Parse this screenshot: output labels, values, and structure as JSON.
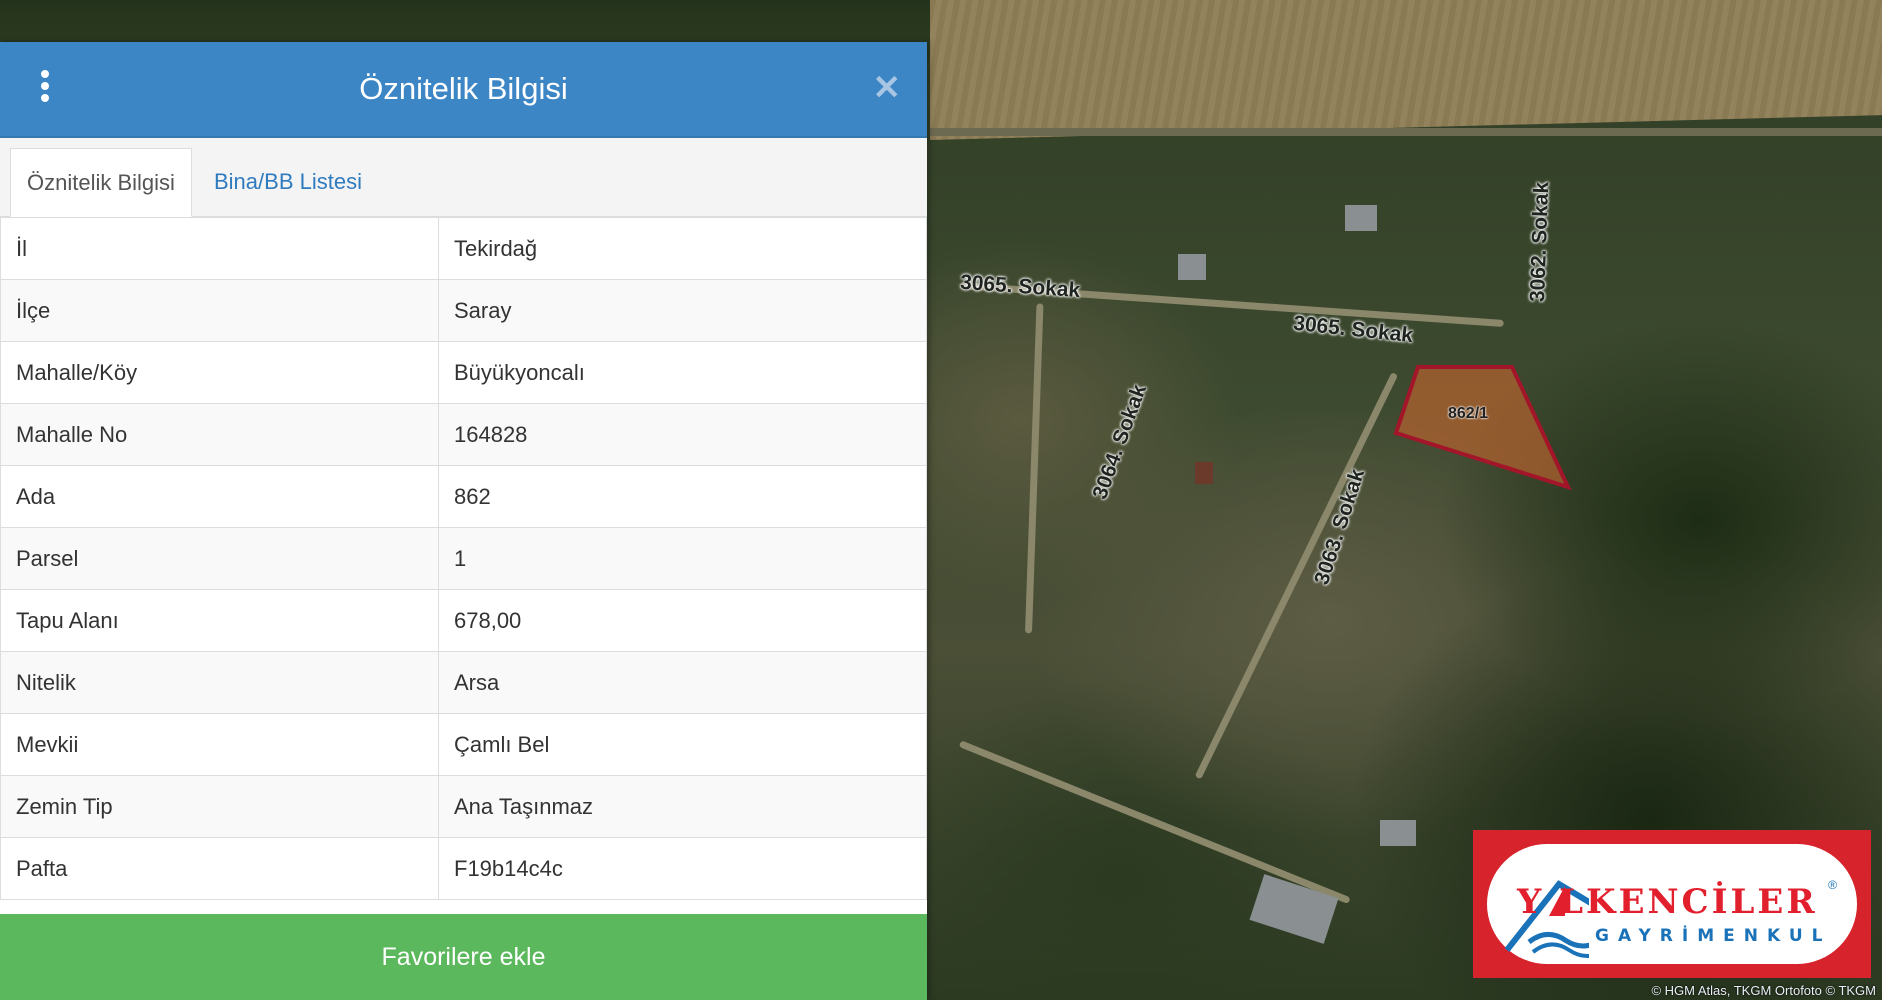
{
  "panel": {
    "title": "Öznitelik Bilgisi",
    "tabs": [
      {
        "label": "Öznitelik Bilgisi",
        "active": true
      },
      {
        "label": "Bina/BB Listesi",
        "active": false
      }
    ],
    "rows": [
      {
        "key": "İl",
        "value": "Tekirdağ"
      },
      {
        "key": "İlçe",
        "value": "Saray"
      },
      {
        "key": "Mahalle/Köy",
        "value": "Büyükyoncalı"
      },
      {
        "key": "Mahalle No",
        "value": "164828"
      },
      {
        "key": "Ada",
        "value": "862"
      },
      {
        "key": "Parsel",
        "value": "1"
      },
      {
        "key": "Tapu Alanı",
        "value": "678,00"
      },
      {
        "key": "Nitelik",
        "value": "Arsa"
      },
      {
        "key": "Mevkii",
        "value": "Çamlı Bel"
      },
      {
        "key": "Zemin Tip",
        "value": "Ana Taşınmaz"
      },
      {
        "key": "Pafta",
        "value": "F19b14c4c"
      }
    ],
    "favorite_button": "Favorilere ekle",
    "icons": {
      "menu": "kebab-menu-icon",
      "close": "close-icon"
    }
  },
  "map": {
    "streets": [
      "3065. Sokak",
      "3065. Sokak",
      "3064. Sokak",
      "3063. Sokak",
      "3062. Sokak"
    ],
    "parcel_label": "862/1",
    "attribution": "© HGM Atlas, TKGM Ortofoto © TKGM",
    "parcel_stroke": "#a3162a",
    "parcel_fill": "#c0652f"
  },
  "logo": {
    "line1": "Y LKENCİLER",
    "line2": "GAYRİMENKUL",
    "mark": "®",
    "colors": {
      "frame": "#d6232c",
      "red": "#e21f2c",
      "blue": "#1a72b8"
    }
  }
}
